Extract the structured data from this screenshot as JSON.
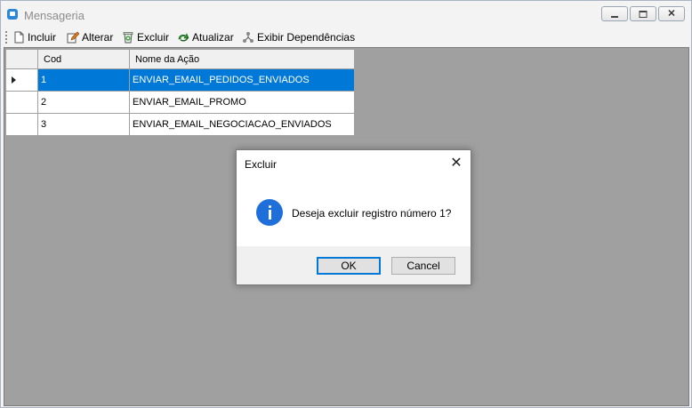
{
  "window": {
    "title": "Mensageria",
    "controls": [
      "minimize",
      "maximize",
      "close"
    ]
  },
  "toolbar": {
    "items": [
      {
        "label": "Incluir",
        "icon": "document-icon"
      },
      {
        "label": "Alterar",
        "icon": "edit-icon"
      },
      {
        "label": "Excluir",
        "icon": "recycle-bin-icon"
      },
      {
        "label": "Atualizar",
        "icon": "refresh-icon"
      },
      {
        "label": "Exibir Dependências",
        "icon": "dependencies-icon"
      }
    ]
  },
  "grid": {
    "columns": [
      "Cod",
      "Nome da Ação"
    ],
    "rows": [
      {
        "cod": "1",
        "nome": "ENVIAR_EMAIL_PEDIDOS_ENVIADOS",
        "selected": true
      },
      {
        "cod": "2",
        "nome": "ENVIAR_EMAIL_PROMO",
        "selected": false
      },
      {
        "cod": "3",
        "nome": "ENVIAR_EMAIL_NEGOCIACAO_ENVIADOS",
        "selected": false
      }
    ]
  },
  "dialog": {
    "title": "Excluir",
    "message": "Deseja excluir registro número 1?",
    "icon": "info-icon",
    "ok_label": "OK",
    "cancel_label": "Cancel"
  },
  "colors": {
    "selection": "#0078d7",
    "client_background": "#a0a0a0",
    "info_icon": "#1e6fd9"
  }
}
